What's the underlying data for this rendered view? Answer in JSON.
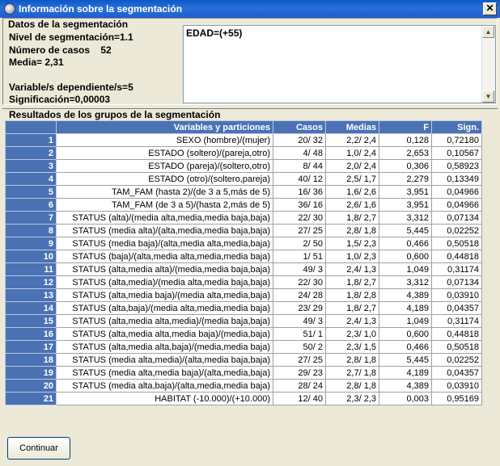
{
  "window": {
    "title": "Información sobre la segmentación",
    "close_glyph": "✕"
  },
  "info": {
    "heading": "Datos de la segmentación",
    "nivel": "Nivel de segmentación=1.1",
    "casos": "Número de casos    52",
    "media": "Media= 2,31",
    "variables": "Variable/s dependiente/s=5",
    "significacion": "Significación=0,00003",
    "textbox": "EDAD=(+55)"
  },
  "results": {
    "heading": "Resultados de los grupos de la segmentación",
    "columns": [
      "",
      "Variables y particiones",
      "Casos",
      "Medias",
      "F",
      "Sign."
    ],
    "rows": [
      [
        "1",
        "SEXO (hombre)/(mujer)",
        "20/ 32",
        "2,2/ 2,4",
        "0,128",
        "0,72180"
      ],
      [
        "2",
        "ESTADO (soltero)/(pareja,otro)",
        "4/ 48",
        "1,0/ 2,4",
        "2,653",
        "0,10567"
      ],
      [
        "3",
        "ESTADO (pareja)/(soltero,otro)",
        "8/ 44",
        "2,0/ 2,4",
        "0,306",
        "0,58923"
      ],
      [
        "4",
        "ESTADO (otro)/(soltero,pareja)",
        "40/ 12",
        "2,5/ 1,7",
        "2,279",
        "0,13349"
      ],
      [
        "5",
        "TAM_FAM (hasta 2)/(de 3 a 5,más de 5)",
        "16/ 36",
        "1,6/ 2,6",
        "3,951",
        "0,04966"
      ],
      [
        "6",
        "TAM_FAM (de 3 a 5)/(hasta 2,más de 5)",
        "36/ 16",
        "2,6/ 1,6",
        "3,951",
        "0,04966"
      ],
      [
        "7",
        "STATUS (alta)/(media alta,media,media baja,baja)",
        "22/ 30",
        "1,8/ 2,7",
        "3,312",
        "0,07134"
      ],
      [
        "8",
        "STATUS (media alta)/(alta,media,media baja,baja)",
        "27/ 25",
        "2,8/ 1,8",
        "5,445",
        "0,02252"
      ],
      [
        "9",
        "STATUS (media baja)/(alta,media alta,media,baja)",
        "2/ 50",
        "1,5/ 2,3",
        "0,466",
        "0,50518"
      ],
      [
        "10",
        "STATUS (baja)/(alta,media alta,media,media baja)",
        "1/ 51",
        "1,0/ 2,3",
        "0,600",
        "0,44818"
      ],
      [
        "11",
        "STATUS (alta,media alta)/(media,media baja,baja)",
        "49/ 3",
        "2,4/ 1,3",
        "1,049",
        "0,31174"
      ],
      [
        "12",
        "STATUS (alta,media)/(media alta,media baja,baja)",
        "22/ 30",
        "1,8/ 2,7",
        "3,312",
        "0,07134"
      ],
      [
        "13",
        "STATUS (alta,media baja)/(media alta,media,baja)",
        "24/ 28",
        "1,8/ 2,8",
        "4,389",
        "0,03910"
      ],
      [
        "14",
        "STATUS (alta,baja)/(media alta,media,media baja)",
        "23/ 29",
        "1,8/ 2,7",
        "4,189",
        "0,04357"
      ],
      [
        "15",
        "STATUS (alta,media alta,media)/(media baja,baja)",
        "49/ 3",
        "2,4/ 1,3",
        "1,049",
        "0,31174"
      ],
      [
        "16",
        "STATUS (alta,media alta,media baja)/(media,baja)",
        "51/ 1",
        "2,3/ 1,0",
        "0,600",
        "0,44818"
      ],
      [
        "17",
        "STATUS (alta,media alta,baja)/(media,media baja)",
        "50/ 2",
        "2,3/ 1,5",
        "0,466",
        "0,50518"
      ],
      [
        "18",
        "STATUS (media alta,media)/(alta,media baja,baja)",
        "27/ 25",
        "2,8/ 1,8",
        "5,445",
        "0,02252"
      ],
      [
        "19",
        "STATUS (media alta,media baja)/(alta,media,baja)",
        "29/ 23",
        "2,7/ 1,8",
        "4,189",
        "0,04357"
      ],
      [
        "20",
        "STATUS (media alta,baja)/(alta,media,media baja)",
        "28/ 24",
        "2,8/ 1,8",
        "4,389",
        "0,03910"
      ],
      [
        "21",
        "HABITAT (-10.000)/(+10.000)",
        "12/ 40",
        "2,3/ 2,3",
        "0,003",
        "0,95169"
      ]
    ]
  },
  "footer": {
    "continue_label": "Continuar"
  }
}
